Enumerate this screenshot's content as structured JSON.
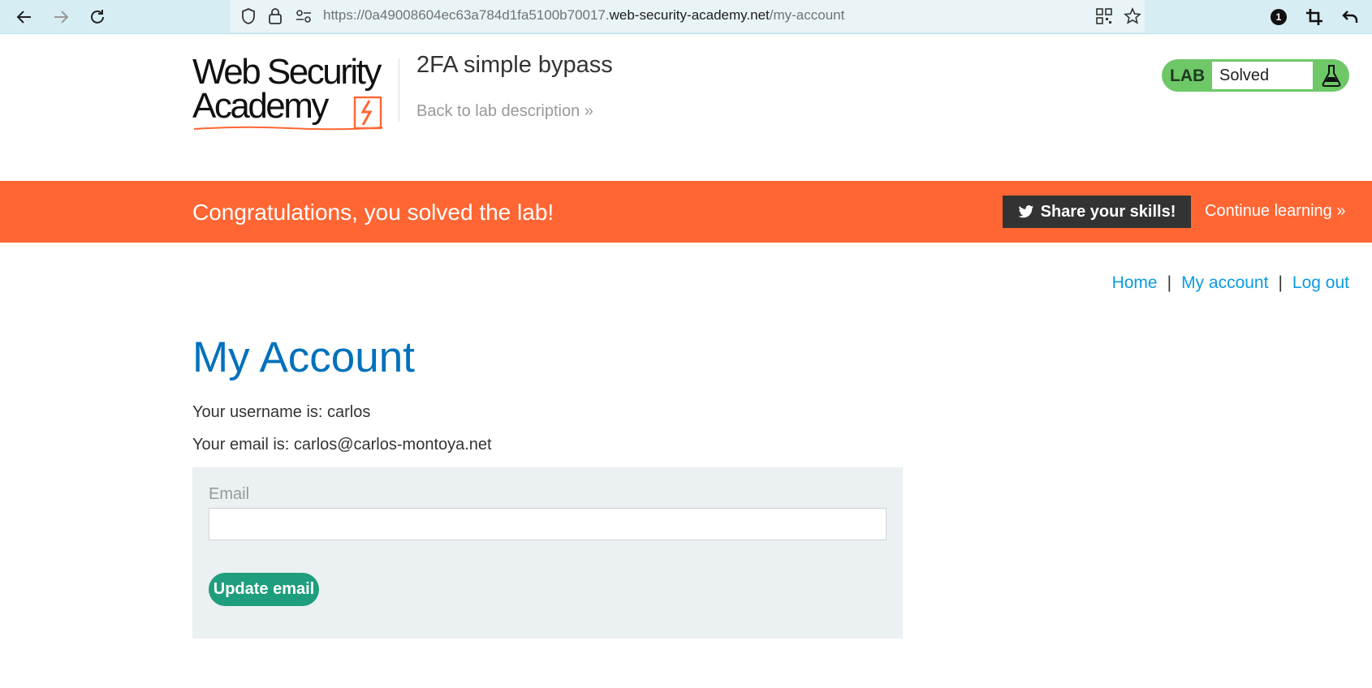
{
  "browser": {
    "url_prefix": "https://0a49008604ec63a784d1fa5100b70017.",
    "url_host": "web-security-academy.net",
    "url_path": "/my-account",
    "notification_count": "1"
  },
  "header": {
    "logo_line1": "Web Security",
    "logo_line2": "Academy",
    "lab_title": "2FA simple bypass",
    "back_link": "Back to lab description",
    "lab_label": "LAB",
    "lab_status": "Solved"
  },
  "banner": {
    "message": "Congratulations, you solved the lab!",
    "share_label": "Share your skills!",
    "continue_label": "Continue learning"
  },
  "nav": {
    "home": "Home",
    "my_account": "My account",
    "log_out": "Log out",
    "separator": "|"
  },
  "main": {
    "title": "My Account",
    "username_line": "Your username is: carlos",
    "email_line": "Your email is: carlos@carlos-montoya.net",
    "form": {
      "email_label": "Email",
      "email_value": "",
      "submit_label": "Update email"
    }
  },
  "colors": {
    "banner": "#ff6633",
    "title": "#0071bc",
    "link": "#0c9be0",
    "lab_solved": "#6ec868",
    "button": "#1e9e7c"
  }
}
